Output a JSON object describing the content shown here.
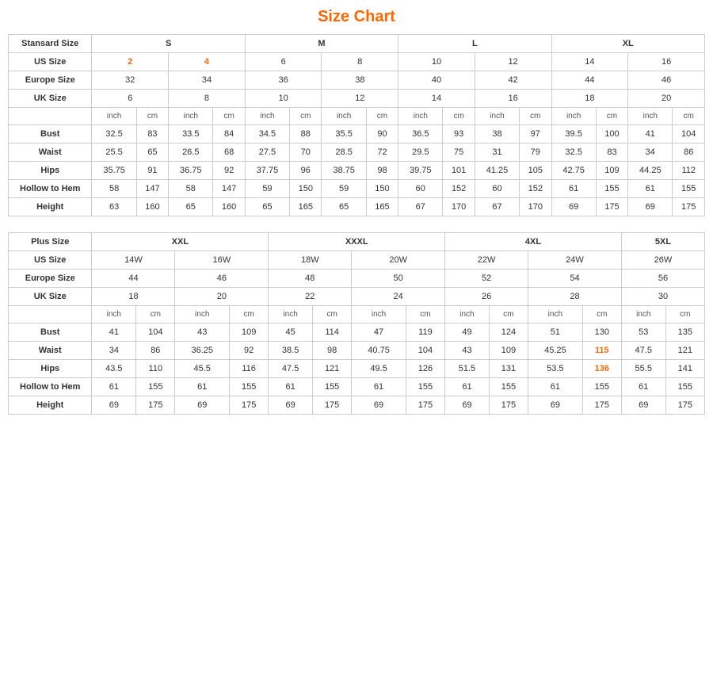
{
  "title": "Size Chart",
  "standard": {
    "sizes": [
      "S",
      "M",
      "L",
      "XL"
    ],
    "us_sizes": [
      "2",
      "4",
      "6",
      "8",
      "10",
      "12",
      "14",
      "16"
    ],
    "europe_sizes": [
      "32",
      "34",
      "36",
      "38",
      "40",
      "42",
      "44",
      "46"
    ],
    "uk_sizes": [
      "6",
      "8",
      "10",
      "12",
      "14",
      "16",
      "18",
      "20"
    ],
    "measurements": {
      "bust": [
        "32.5",
        "83",
        "33.5",
        "84",
        "34.5",
        "88",
        "35.5",
        "90",
        "36.5",
        "93",
        "38",
        "97",
        "39.5",
        "100",
        "41",
        "104"
      ],
      "waist": [
        "25.5",
        "65",
        "26.5",
        "68",
        "27.5",
        "70",
        "28.5",
        "72",
        "29.5",
        "75",
        "31",
        "79",
        "32.5",
        "83",
        "34",
        "86"
      ],
      "hips": [
        "35.75",
        "91",
        "36.75",
        "92",
        "37.75",
        "96",
        "38.75",
        "98",
        "39.75",
        "101",
        "41.25",
        "105",
        "42.75",
        "109",
        "44.25",
        "112"
      ],
      "hollow": [
        "58",
        "147",
        "58",
        "147",
        "59",
        "150",
        "59",
        "150",
        "60",
        "152",
        "60",
        "152",
        "61",
        "155",
        "61",
        "155"
      ],
      "height": [
        "63",
        "160",
        "65",
        "160",
        "65",
        "165",
        "65",
        "165",
        "67",
        "170",
        "67",
        "170",
        "69",
        "175",
        "69",
        "175"
      ]
    }
  },
  "plus": {
    "sizes": [
      "XXL",
      "XXXL",
      "4XL",
      "5XL"
    ],
    "us_sizes": [
      "14W",
      "16W",
      "18W",
      "20W",
      "22W",
      "24W",
      "26W"
    ],
    "europe_sizes": [
      "44",
      "46",
      "48",
      "50",
      "52",
      "54",
      "56"
    ],
    "uk_sizes": [
      "18",
      "20",
      "22",
      "24",
      "26",
      "28",
      "30"
    ],
    "measurements": {
      "bust": [
        "41",
        "104",
        "43",
        "109",
        "45",
        "114",
        "47",
        "119",
        "49",
        "124",
        "51",
        "130",
        "53",
        "135"
      ],
      "waist": [
        "34",
        "86",
        "36.25",
        "92",
        "38.5",
        "98",
        "40.75",
        "104",
        "43",
        "109",
        "45.25",
        "115",
        "47.5",
        "121"
      ],
      "hips": [
        "43.5",
        "110",
        "45.5",
        "116",
        "47.5",
        "121",
        "49.5",
        "126",
        "51.5",
        "131",
        "53.5",
        "136",
        "55.5",
        "141"
      ],
      "hollow": [
        "61",
        "155",
        "61",
        "155",
        "61",
        "155",
        "61",
        "155",
        "61",
        "155",
        "61",
        "155",
        "61",
        "155"
      ],
      "height": [
        "69",
        "175",
        "69",
        "175",
        "69",
        "175",
        "69",
        "175",
        "69",
        "175",
        "69",
        "175",
        "69",
        "175"
      ]
    }
  },
  "labels": {
    "standard_size": "Stansard Size",
    "plus_size": "Plus Size",
    "us_size": "US Size",
    "europe_size": "Europe Size",
    "uk_size": "UK Size",
    "bust": "Bust",
    "waist": "Waist",
    "hips": "Hips",
    "hollow": "Hollow to Hem",
    "height": "Height",
    "inch": "inch",
    "cm": "cm"
  }
}
